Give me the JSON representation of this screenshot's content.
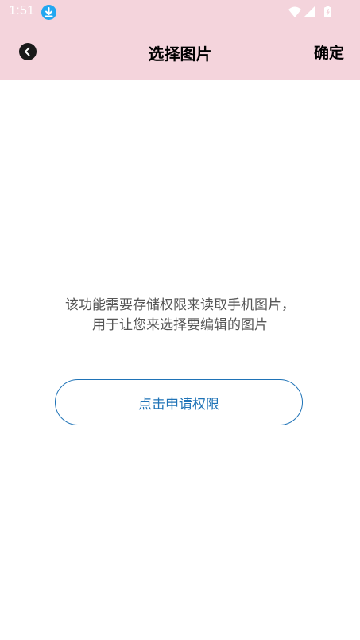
{
  "status_bar": {
    "time": "1:51",
    "icons": [
      "download-icon",
      "wifi-icon",
      "signal-icon",
      "battery-charging-icon"
    ]
  },
  "header": {
    "title": "选择图片",
    "confirm_label": "确定",
    "back_icon": "chevron-left-icon"
  },
  "main": {
    "permission_line1": "该功能需要存储权限来读取手机图片，",
    "permission_line2": "用于让您来选择要编辑的图片",
    "request_button_label": "点击申请权限"
  },
  "colors": {
    "header_background": "#f4d4dc",
    "accent": "#1f73b7",
    "download_badge": "#22a7f0"
  }
}
